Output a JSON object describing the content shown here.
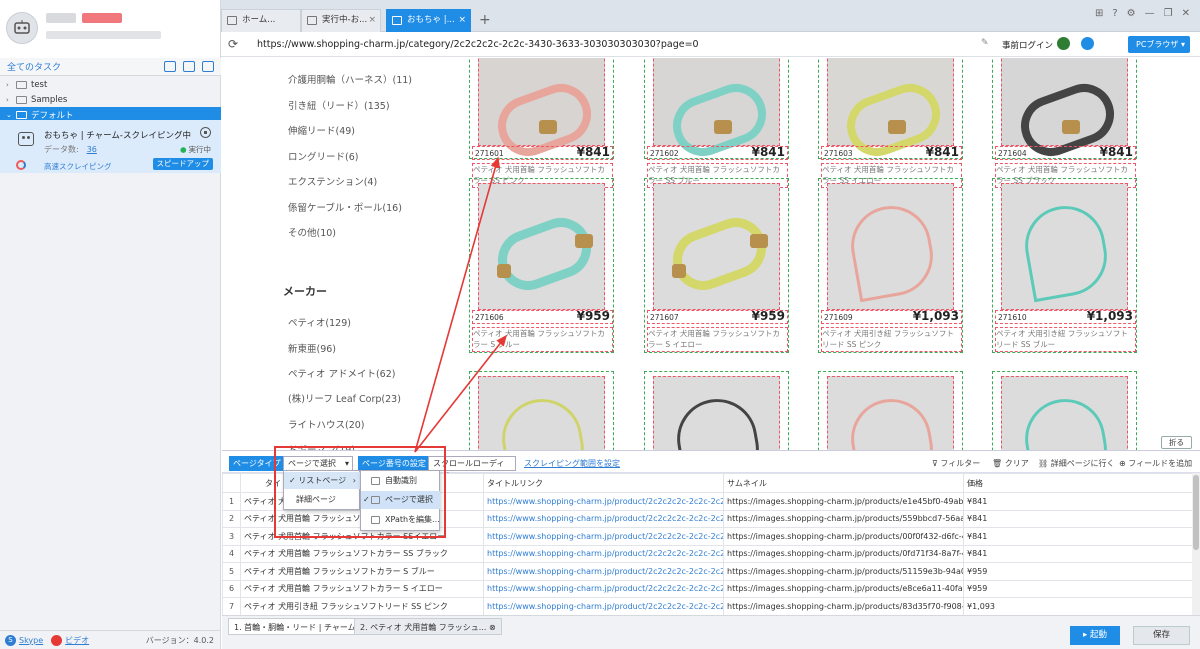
{
  "sidebar": {
    "all_tasks": "全てのタスク",
    "folders": [
      {
        "label": "test"
      },
      {
        "label": "Samples"
      },
      {
        "label": "デフォルト"
      }
    ],
    "task": {
      "title": "おもちゃ | チャーム-スクレイピング中",
      "data_count_label": "データ数:",
      "data_count": "36",
      "status": "実行中",
      "speed_label": "高速スクレイピング",
      "speedup_button": "スピードアップ"
    },
    "footer": {
      "skype": "Skype",
      "video": "ビデオ",
      "version": "バージョン：4.0.2"
    }
  },
  "browser": {
    "tabs": [
      {
        "label": "ホーム..."
      },
      {
        "label": "実行中-お..."
      },
      {
        "label": "おもちゃ |..."
      }
    ],
    "url": "https://www.shopping-charm.jp/category/2c2c2c2c-2c2c-3430-3633-303030303030?page=0",
    "prelogin": "事前ログイン",
    "pc_browser": "PCブラウザ"
  },
  "webpage": {
    "categories": [
      "介護用胴輪（ハーネス）(11)",
      "引き紐（リード）(135)",
      "伸縮リード(49)",
      "ロングリード(6)",
      "エクステンション(4)",
      "係留ケーブル・ポール(16)",
      "その他(10)"
    ],
    "maker_heading": "メーカー",
    "makers": [
      "ペティオ(129)",
      "新東亜(96)",
      "ペティオ アドメイト(62)",
      "(株)リーフ Leaf Corp(23)",
      "ライトハウス(20)",
      "ドギーマン(19)"
    ],
    "products": [
      {
        "id": "271601",
        "price": "¥841",
        "name": "ペティオ 犬用首輪 フラッシュソフトカラー SS ピンク"
      },
      {
        "id": "271602",
        "price": "¥841",
        "name": "ペティオ 犬用首輪 フラッシュソフトカラー SS ブルー"
      },
      {
        "id": "271603",
        "price": "¥841",
        "name": "ペティオ 犬用首輪 フラッシュソフトカラー SS イエロー"
      },
      {
        "id": "271604",
        "price": "¥841",
        "name": "ペティオ 犬用首輪 フラッシュソフトカラー SS ブラック"
      },
      {
        "id": "271606",
        "price": "¥959",
        "name": "ペティオ 犬用首輪 フラッシュソフトカラー S ブルー"
      },
      {
        "id": "271607",
        "price": "¥959",
        "name": "ペティオ 犬用首輪 フラッシュソフトカラー S イエロー"
      },
      {
        "id": "271609",
        "price": "¥1,093",
        "name": "ペティオ 犬用引き紐 フラッシュソフトリード SS ピンク"
      },
      {
        "id": "271610",
        "price": "¥1,093",
        "name": "ペティオ 犬用引き紐 フラッシュソフトリード SS ブルー"
      }
    ],
    "fold_button": "折る"
  },
  "toolbar": {
    "page_type": "ページタイプ",
    "page_type_select": "ページで選択",
    "page_number_settings": "ページ番号の設定",
    "scroll_select": "スクロールローディング",
    "scrape_range": "スクレイピング範囲を設定",
    "filter": "フィルター",
    "clear": "クリア",
    "goto_detail": "詳細ページに行く",
    "add_field": "フィールドを追加"
  },
  "dropdown1": {
    "items": [
      "リストページ",
      "詳細ページ"
    ]
  },
  "dropdown2": {
    "items": [
      "自動識別",
      "ページで選択",
      "XPathを編集..."
    ]
  },
  "table": {
    "columns": [
      "",
      "タイトル",
      "タイトルリンク",
      "サムネイル",
      "価格"
    ],
    "rows": [
      {
        "n": "1",
        "title": "ペティオ 犬用首輪 フラッシュソフトカラー SS ピンク",
        "link": "https://www.shopping-charm.jp/product/2c2c2c2c-2c2c-2c2c-2c2c...",
        "thumb": "https://images.shopping-charm.jp/products/e1e45bf0-49ab-43c2-a9...",
        "price": "¥841"
      },
      {
        "n": "2",
        "title": "ペティオ 犬用首輪 フラッシュソフトカラー SS ブルー",
        "link": "https://www.shopping-charm.jp/product/2c2c2c2c-2c2c-2c2c-2c2c...",
        "thumb": "https://images.shopping-charm.jp/products/559bbcd7-56aa-4229-b...",
        "price": "¥841"
      },
      {
        "n": "3",
        "title": "ペティオ 犬用首輪 フラッシュソフトカラー SSイエロー",
        "link": "https://www.shopping-charm.jp/product/2c2c2c2c-2c2c-2c2c-2c2c...",
        "thumb": "https://images.shopping-charm.jp/products/00f0f432-d6fc-49cb-b98...",
        "price": "¥841"
      },
      {
        "n": "4",
        "title": "ペティオ 犬用首輪 フラッシュソフトカラー SS ブラック",
        "link": "https://www.shopping-charm.jp/product/2c2c2c2c-2c2c-2c2c-2c2c...",
        "thumb": "https://images.shopping-charm.jp/products/0fd71f34-8a7f-46e8-982...",
        "price": "¥841"
      },
      {
        "n": "5",
        "title": "ペティオ 犬用首輪 フラッシュソフトカラー S ブルー",
        "link": "https://www.shopping-charm.jp/product/2c2c2c2c-2c2c-2c2c-2c2c...",
        "thumb": "https://images.shopping-charm.jp/products/51159e3b-94a0-4bf8-bff...",
        "price": "¥959"
      },
      {
        "n": "6",
        "title": "ペティオ 犬用首輪 フラッシュソフトカラー S イエロー",
        "link": "https://www.shopping-charm.jp/product/2c2c2c2c-2c2c-2c2c-2c2c...",
        "thumb": "https://images.shopping-charm.jp/products/e8ce6a11-40fa-4635-81...",
        "price": "¥959"
      },
      {
        "n": "7",
        "title": "ペティオ 犬用引き紐 フラッシュソフトリード SS ピンク",
        "link": "https://www.shopping-charm.jp/product/2c2c2c2c-2c2c-2c2c-2c2c...",
        "thumb": "https://images.shopping-charm.jp/products/83d35f70-f908-488e-bf6...",
        "price": "¥1,093"
      }
    ]
  },
  "bottom": {
    "tabs": [
      "1. 首輪・胴輪・リード | チャーム",
      "2. ペティオ 犬用首輪 フラッシュ..."
    ],
    "start": "起動",
    "save": "保存"
  },
  "colors": {
    "accent": "#1f8ce6",
    "highlight": "#e53935",
    "product_border": "#3cab55"
  }
}
